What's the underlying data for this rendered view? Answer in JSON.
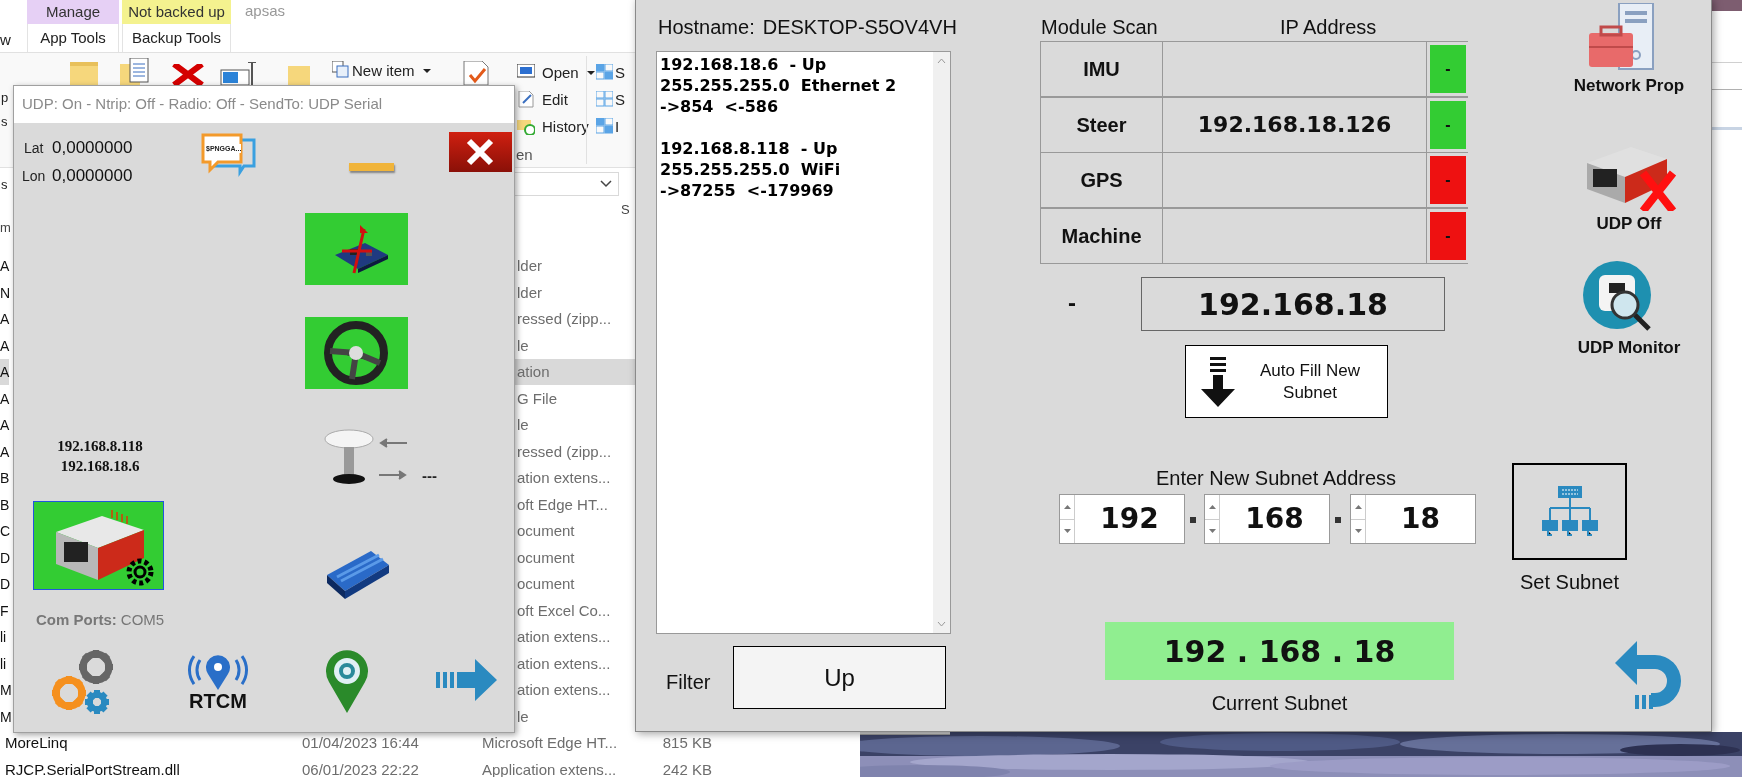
{
  "explorer": {
    "tab_fragment": "w",
    "window_title": "apsas",
    "context_groups": [
      {
        "tab": "Manage",
        "group": "App Tools",
        "color": "#e6d0f5"
      },
      {
        "tab": "Not backed up",
        "group": "Backup Tools",
        "color": "#f4f28f"
      }
    ],
    "ribbon_fragments": [
      "p",
      "s"
    ],
    "new_item": "New item",
    "open_items": [
      "Open",
      "Edit",
      "History"
    ],
    "group_label": "en",
    "select_fragments": [
      "S",
      "S",
      "I"
    ],
    "address_fragment": "s",
    "header_fragments": [
      "m",
      "S"
    ],
    "files": [
      {
        "name": "A",
        "type": "lder",
        "selected": false
      },
      {
        "name": "N",
        "type": "lder",
        "selected": false
      },
      {
        "name": "A",
        "type": "ressed (zipp...",
        "selected": false
      },
      {
        "name": "A",
        "type": "le",
        "selected": false
      },
      {
        "name": "A",
        "type": "ation",
        "selected": true
      },
      {
        "name": "A",
        "type": "G File",
        "selected": false
      },
      {
        "name": "A",
        "type": "le",
        "selected": false
      },
      {
        "name": "A",
        "type": "ressed (zipp...",
        "selected": false
      },
      {
        "name": "B",
        "type": "ation extens...",
        "selected": false
      },
      {
        "name": "B",
        "type": "oft Edge HT...",
        "selected": false
      },
      {
        "name": "C",
        "type": "ocument",
        "selected": false
      },
      {
        "name": "D",
        "type": "ocument",
        "selected": false
      },
      {
        "name": "D",
        "type": "ocument",
        "selected": false
      },
      {
        "name": "F",
        "type": "oft Excel Co...",
        "selected": false
      },
      {
        "name": "li",
        "type": "ation extens...",
        "selected": false
      },
      {
        "name": "li",
        "type": "ation extens...",
        "selected": false
      },
      {
        "name": "M",
        "type": "ation extens...",
        "selected": false
      },
      {
        "name": "M",
        "type": "le",
        "selected": false
      },
      {
        "name": "MoreLinq",
        "date": "01/04/2023 16:44",
        "type": "Microsoft Edge HT...",
        "size": "815 KB",
        "selected": false
      },
      {
        "name": "RJCP.SerialPortStream.dll",
        "date": "06/01/2023 22:22",
        "type": "Application extens...",
        "size": "242 KB",
        "selected": false
      }
    ]
  },
  "udp_window": {
    "title": "UDP: On - Ntrip: Off - Radio: Off - SendTo: UDP Serial",
    "lat_label": "Lat",
    "lat": "0,0000000",
    "lon_label": "Lon",
    "lon": "0,0000000",
    "nmea_label": "$PNGGA...",
    "ips": [
      "192.168.8.118",
      "192.168.18.6"
    ],
    "gps_reading": "---",
    "modules": [
      {
        "kind": "imu",
        "active": true,
        "selected": false
      },
      {
        "kind": "steer",
        "active": true,
        "selected": false
      },
      {
        "kind": "ethernet",
        "active": true,
        "selected": true
      },
      {
        "kind": "relay",
        "active": false,
        "selected": false
      }
    ],
    "com_label": "Com Ports:",
    "com_value": "COM5",
    "rtcm_label": "RTCM"
  },
  "main": {
    "hostname_label": "Hostname:",
    "hostname": "DESKTOP-S5OV4VH",
    "log_blocks": [
      [
        "192.168.18.6  - Up",
        "255.255.255.0  Ethernet 2",
        "->854  <-586"
      ],
      [
        "192.168.8.118  - Up",
        "255.255.255.0  WiFi",
        "->87255  <-179969"
      ]
    ],
    "filter_label": "Filter",
    "filter_value": "Up",
    "scan_headers": [
      "Module Scan",
      "IP Address"
    ],
    "modules": [
      {
        "name": "IMU",
        "status": "-",
        "found": true
      },
      {
        "name": "Steer",
        "ip": "192.168.18.126",
        "status": "-",
        "found": true
      },
      {
        "name": "GPS",
        "status": "-",
        "found": false
      },
      {
        "name": "Machine",
        "status": "-",
        "found": false
      }
    ],
    "scan_status": "-",
    "subnet_display": "192.168.18",
    "autofill_label": "Auto Fill New Subnet",
    "enter_label": "Enter New Subnet Address",
    "octets": [
      "192",
      "168",
      "18"
    ],
    "set_subnet_label": "Set Subnet",
    "current_subnet": "192 . 168 . 18",
    "current_subnet_label": "Current Subnet",
    "side_buttons": [
      {
        "kind": "network",
        "label": "Network Prop"
      },
      {
        "kind": "udp_off",
        "label": "UDP Off"
      },
      {
        "kind": "monitor",
        "label": "UDP Monitor"
      }
    ]
  }
}
